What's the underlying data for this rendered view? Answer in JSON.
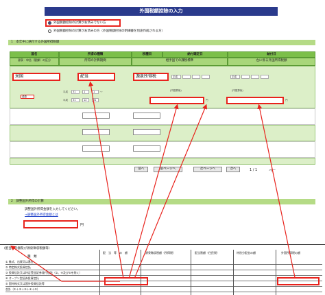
{
  "title": "外国税額控除の入力",
  "radio_options": [
    "外国税額控除の計算がお済みでない方",
    "外国税額控除の計算がお済みの方（外国税額控除の明細書を別途作成される方）"
  ],
  "section1": {
    "label": "1　本年中に納付する外国所得税額"
  },
  "table": {
    "headers_top": [
      "国名",
      "所得の種類",
      "税種目",
      "納付確定日",
      "納付日"
    ],
    "headers_sub": [
      "源泉・申告（賦課）の区分",
      "所得の計算期間",
      "相手国での課税標準",
      "左に係る外国所得税額"
    ],
    "row1": {
      "country": "米国",
      "income_type": "配当",
      "tax_item": "源泉所得税",
      "category_select": "源泉",
      "era": "平成",
      "from_year": "31",
      "from_month": "1",
      "from_day": "1",
      "to_year": "31",
      "to_month": "12",
      "to_day": "31",
      "tax_base_label": "(円換算後)",
      "tax_base_amount": "",
      "tax_amount_label": "(円換算後)",
      "tax_amount": "",
      "unit_yen": "円"
    },
    "era_label": "平成",
    "slash": "〜"
  },
  "pager": {
    "prev": "前へ",
    "prev_page": "前ページへ",
    "next_page": "次ページへ",
    "next": "次へ",
    "page": "1 / 1",
    "page_label": "ペー"
  },
  "section2": {
    "label": "2　調整国外所得の計算",
    "description": "調整国外所得金額を入力してください。",
    "link": "→調整国外所得金額とは",
    "amount": "",
    "unit": "円"
  },
  "ledger": {
    "title": "(配当等の額及び源泉徴収税額等)",
    "col_kind": "種　類",
    "col_dividend": "配　当　等　の　額",
    "col_withholding": "源泉徴収税額（所得税）",
    "col_local": "配当割額（住民税）",
    "col_special": "特別分配金の額",
    "col_foreign": "外国所得税の額",
    "rows": [
      "① 株式、出資又は基金",
      "② 特定株式投資信託",
      "③ 投資信託又は特定受益証券発行信託（②、④及び⑤を除く）",
      "④ オープン型証券投資信託",
      "⑤ 国外株式又は国外投資信託等",
      "合計（①＋②＋③＋④＋⑤）"
    ]
  },
  "colors": {
    "title_bg": "#2a3a8c",
    "header_green": "#7cbf4a",
    "row_green": "#dcefc8",
    "highlight_red": "#e8221c"
  }
}
